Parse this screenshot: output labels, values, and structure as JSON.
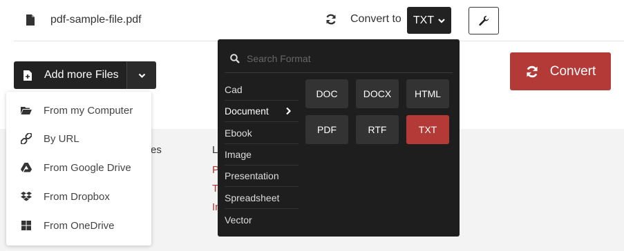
{
  "file": {
    "name": "pdf-sample-file.pdf",
    "icon": "file-icon"
  },
  "toolbar": {
    "convert_to_label": "Convert to",
    "selected_format": "TXT",
    "settings_icon": "wrench-icon"
  },
  "add_files": {
    "label": "Add more Files",
    "menu": [
      {
        "label": "From my Computer",
        "icon": "folder-open-icon"
      },
      {
        "label": "By URL",
        "icon": "link-icon"
      },
      {
        "label": "From Google Drive",
        "icon": "google-drive-icon"
      },
      {
        "label": "From Dropbox",
        "icon": "dropbox-icon"
      },
      {
        "label": "From OneDrive",
        "icon": "onedrive-icon"
      }
    ]
  },
  "convert_button": {
    "label": "Convert",
    "icon": "refresh-icon"
  },
  "background_fragments": {
    "col1_heading": "es",
    "col2_heading": "L",
    "col2_links": [
      "P",
      "T",
      "In"
    ]
  },
  "format_panel": {
    "search_placeholder": "Search Format",
    "categories": [
      {
        "label": "Cad",
        "active": false
      },
      {
        "label": "Document",
        "active": true
      },
      {
        "label": "Ebook",
        "active": false
      },
      {
        "label": "Image",
        "active": false
      },
      {
        "label": "Presentation",
        "active": false
      },
      {
        "label": "Spreadsheet",
        "active": false
      },
      {
        "label": "Vector",
        "active": false
      }
    ],
    "formats": [
      {
        "label": "DOC",
        "selected": false
      },
      {
        "label": "DOCX",
        "selected": false
      },
      {
        "label": "HTML",
        "selected": false
      },
      {
        "label": "PDF",
        "selected": false
      },
      {
        "label": "RTF",
        "selected": false
      },
      {
        "label": "TXT",
        "selected": true
      }
    ]
  },
  "colors": {
    "accent": "#b33a37",
    "dark": "#222222",
    "panel": "#1e1e1e"
  }
}
